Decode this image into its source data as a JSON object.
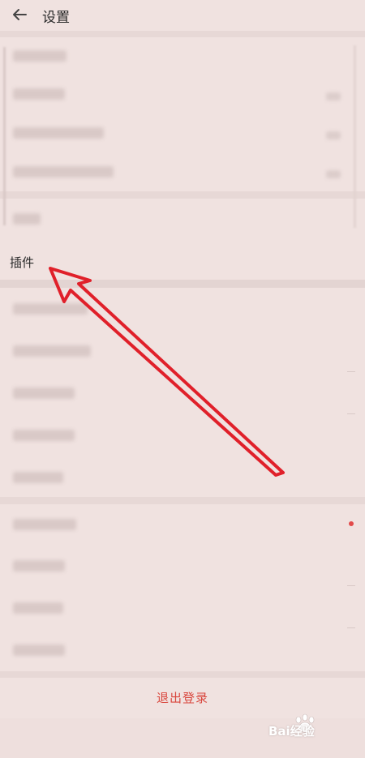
{
  "header": {
    "title": "设置",
    "back_icon": "arrow-left-icon"
  },
  "plugins": {
    "label": "插件"
  },
  "logout": {
    "label": "退出登录"
  },
  "watermark": {
    "text": "Bai经验"
  },
  "colors": {
    "accent": "#e24a4a",
    "logout": "#d9473e",
    "background": "#eedfdd"
  }
}
